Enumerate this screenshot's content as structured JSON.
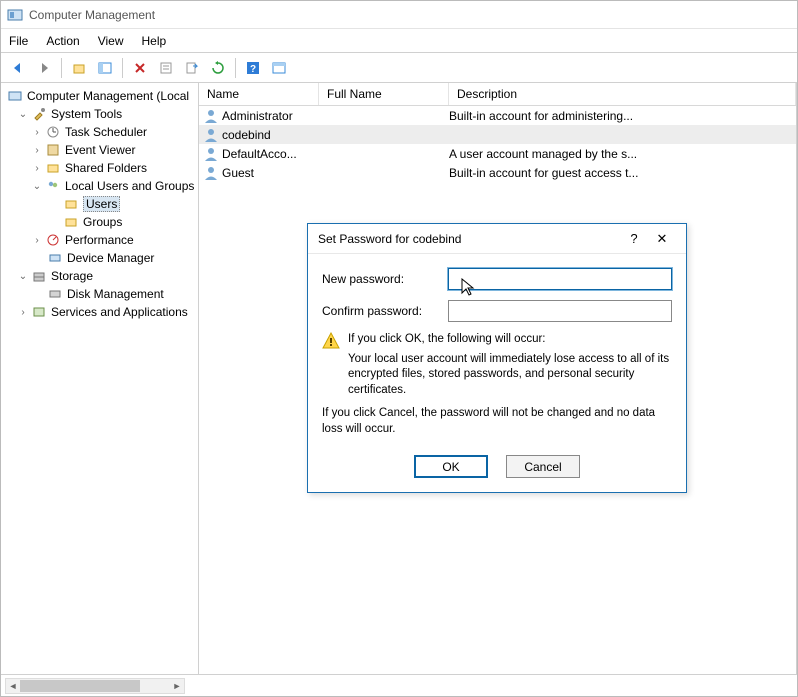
{
  "window": {
    "title": "Computer Management"
  },
  "menu": {
    "file": "File",
    "action": "Action",
    "view": "View",
    "help": "Help"
  },
  "tree": {
    "root": "Computer Management (Local",
    "system_tools": "System Tools",
    "task_scheduler": "Task Scheduler",
    "event_viewer": "Event Viewer",
    "shared_folders": "Shared Folders",
    "local_users_groups": "Local Users and Groups",
    "users": "Users",
    "groups": "Groups",
    "performance": "Performance",
    "device_manager": "Device Manager",
    "storage": "Storage",
    "disk_management": "Disk Management",
    "services_apps": "Services and Applications"
  },
  "list": {
    "columns": {
      "name": "Name",
      "full_name": "Full Name",
      "description": "Description"
    },
    "rows": [
      {
        "name": "Administrator",
        "full": "",
        "desc": "Built-in account for administering..."
      },
      {
        "name": "codebind",
        "full": "",
        "desc": ""
      },
      {
        "name": "DefaultAcco...",
        "full": "",
        "desc": "A user account managed by the s..."
      },
      {
        "name": "Guest",
        "full": "",
        "desc": "Built-in account for guest access t..."
      }
    ]
  },
  "dialog": {
    "title": "Set Password for codebind",
    "new_password_label": "New password:",
    "confirm_password_label": "Confirm password:",
    "warn_heading": "If you click OK, the following will occur:",
    "warn_body": "Your local user account will immediately lose access to all of its encrypted files, stored passwords, and personal security certificates.",
    "cancel_info": "If you click Cancel, the password will not be changed and no data loss will occur.",
    "ok": "OK",
    "cancel": "Cancel"
  }
}
